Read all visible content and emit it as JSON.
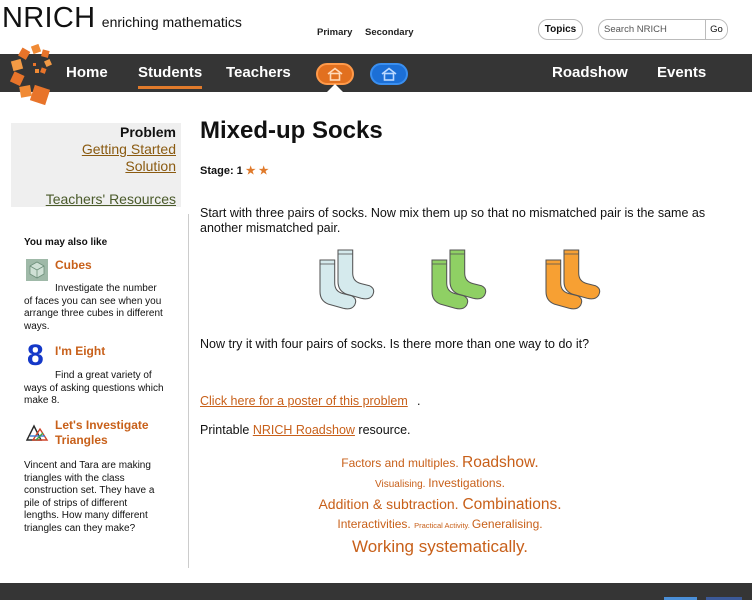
{
  "header": {
    "brand_name": "NRICH",
    "brand_tagline": "enriching mathematics",
    "section_labels": {
      "primary": "Primary",
      "secondary": "Secondary"
    },
    "topics_label": "Topics",
    "search_placeholder": "Search NRICH",
    "search_go": "Go"
  },
  "nav": {
    "items": [
      "Home",
      "Students",
      "Teachers",
      "Roadshow",
      "Events"
    ],
    "active": "Students"
  },
  "sidebar": {
    "heading": "Problem",
    "links": [
      "Getting Started",
      "Solution",
      "Teachers' Resources"
    ],
    "also_heading": "You may also like",
    "related": [
      {
        "title": "Cubes",
        "icon": "cubes-icon",
        "desc_lines": [
          "Investigate the number",
          "of faces you can see when you",
          "arrange three cubes in different",
          "ways."
        ]
      },
      {
        "title": "I'm Eight",
        "icon": "eight-icon",
        "icon_text": "8",
        "desc_lines": [
          "Find a great variety of",
          "ways of asking questions which",
          "make 8."
        ]
      },
      {
        "title_lines": [
          "Let's Investigate",
          "Triangles"
        ],
        "icon": "triangles-icon",
        "desc_lines": [
          "Vincent and Tara are making",
          "triangles with the class",
          "construction set. They have a",
          "pile of strips of different",
          "lengths. How many different",
          "triangles can they make?"
        ]
      }
    ]
  },
  "main": {
    "title": "Mixed-up Socks",
    "stage_label": "Stage: 1",
    "stage_stars": "★ ★",
    "para1": "Start with three pairs of socks. Now mix them up so that no mismatched pair is the same as another mismatched pair.",
    "para2": "Now try it with four pairs of socks. Is there more than one way to do it?",
    "poster_link": "Click here for a poster of this problem",
    "poster_after": ".",
    "printable_before": "Printable ",
    "printable_link": "NRICH Roadshow",
    "printable_after": " resource.",
    "tags": {
      "factors": "Factors and multiples",
      "roadshow": "Roadshow",
      "visualising": "Visualising",
      "investigations": "Investigations",
      "addition": "Addition & subtraction",
      "combinations": "Combinations",
      "interactivities": "Interactivities",
      "practical": "Practical Activity",
      "generalising": "Generalising",
      "working": "Working systematically"
    },
    "sock_colors": [
      "#d5eaed",
      "#8fd064",
      "#f7a033"
    ]
  },
  "colors": {
    "accent_orange": "#e07a2b",
    "nav_bg": "#353535",
    "primary_pill": "#e2701f",
    "secondary_pill": "#1c6fd6",
    "link": "#c8601a"
  }
}
